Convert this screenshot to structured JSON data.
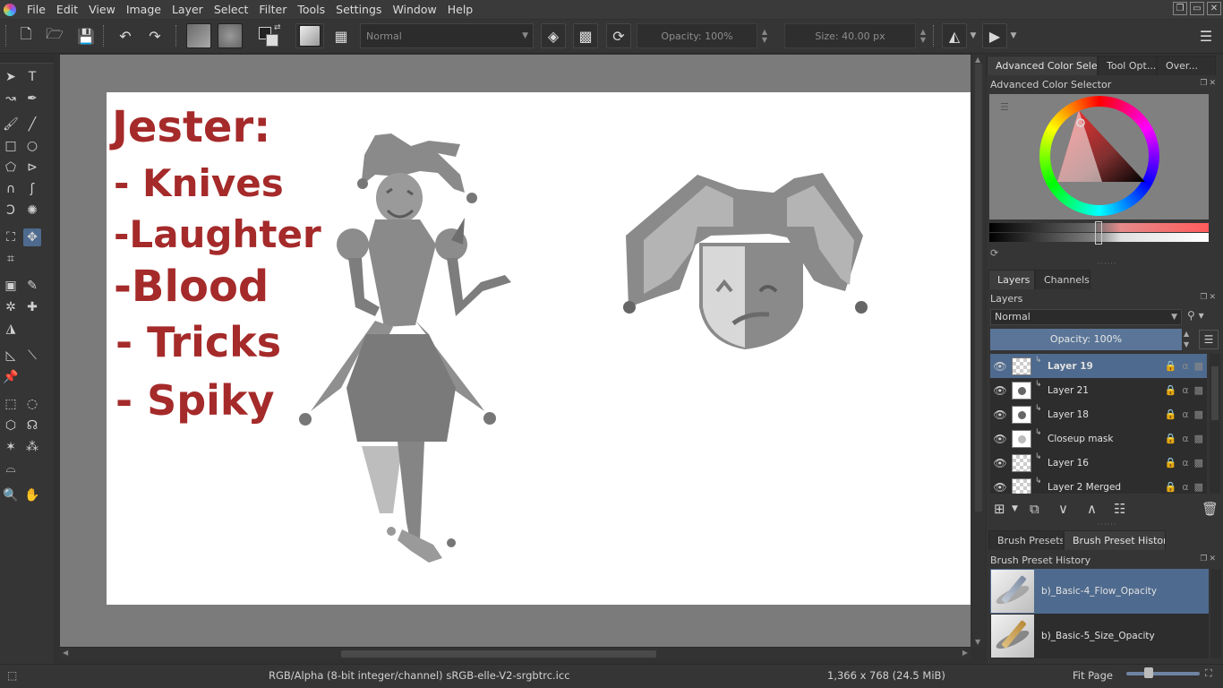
{
  "menubar": {
    "items": [
      "File",
      "Edit",
      "View",
      "Image",
      "Layer",
      "Select",
      "Filter",
      "Tools",
      "Settings",
      "Window",
      "Help"
    ]
  },
  "toolbar": {
    "blend_mode": "Normal",
    "opacity_label": "Opacity: 100%",
    "size_label": "Size: 40.00 px"
  },
  "canvas": {
    "title": "Jester:",
    "list": [
      "- Knives",
      "-Laughter",
      "-Blood",
      "- Tricks",
      "- Spiky"
    ]
  },
  "docker": {
    "top_tabs": [
      "Advanced Color Sele...",
      "Tool Opt...",
      "Over..."
    ],
    "color_panel_title": "Advanced Color Selector",
    "layer_tabs": [
      "Layers",
      "Channels"
    ],
    "layers_panel_title": "Layers",
    "blend_mode": "Normal",
    "opacity_label": "Opacity:  100%",
    "layers": [
      {
        "name": "Layer 19",
        "selected": true
      },
      {
        "name": "Layer 21",
        "selected": false
      },
      {
        "name": "Layer 18",
        "selected": false
      },
      {
        "name": "Closeup mask",
        "selected": false
      },
      {
        "name": "Layer 16",
        "selected": false
      },
      {
        "name": "Layer 2 Merged",
        "selected": false
      }
    ],
    "brush_tabs": [
      "Brush Presets",
      "Brush Preset History"
    ],
    "brush_panel_title": "Brush Preset History",
    "brushes": [
      {
        "name": "b)_Basic-4_Flow_Opacity",
        "selected": true
      },
      {
        "name": "b)_Basic-5_Size_Opacity",
        "selected": false
      }
    ]
  },
  "statusbar": {
    "color_info": "RGB/Alpha (8-bit integer/channel)  sRGB-elle-V2-srgbtrc.icc",
    "doc_size": "1,366 x 768 (24.5 MiB)",
    "zoom_label": "Fit Page"
  },
  "colors": {
    "accent": "#4e6a8e",
    "canvas_text": "#a52a2a",
    "canvas_bg": "#7b7b7b"
  }
}
